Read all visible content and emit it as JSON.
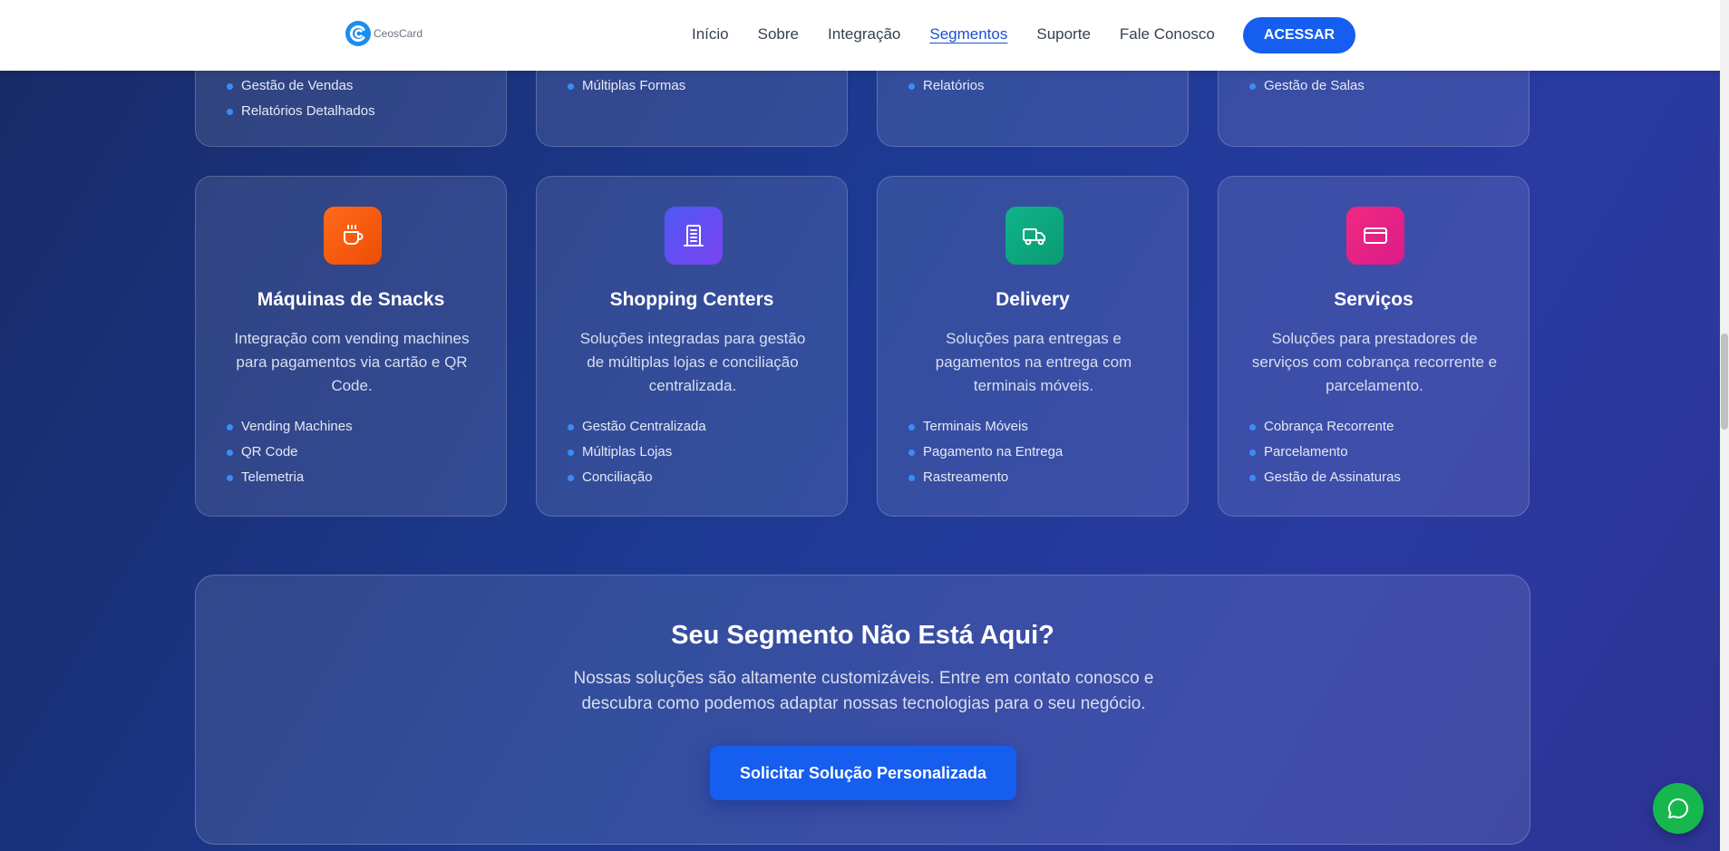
{
  "header": {
    "brand": "CeosCard",
    "nav": [
      "Início",
      "Sobre",
      "Integração",
      "Segmentos",
      "Suporte",
      "Fale Conosco"
    ],
    "active_nav": "Segmentos",
    "access_label": "ACESSAR"
  },
  "top_cards": [
    {
      "items": [
        "Gestão de Vendas",
        "Relatórios Detalhados"
      ]
    },
    {
      "items": [
        "Múltiplas Formas"
      ]
    },
    {
      "items": [
        "Relatórios"
      ]
    },
    {
      "items": [
        "Gestão de Salas"
      ]
    }
  ],
  "cards": [
    {
      "title": "Máquinas de Snacks",
      "icon": "coffee-cup-icon",
      "color": "#f05a0e",
      "description": "Integração com vending machines para pagamentos via cartão e QR Code.",
      "items": [
        "Vending Machines",
        "QR Code",
        "Telemetria"
      ]
    },
    {
      "title": "Shopping Centers",
      "icon": "building-icon",
      "color": "#6d4bf2",
      "description": "Soluções integradas para gestão de múltiplas lojas e conciliação centralizada.",
      "items": [
        "Gestão Centralizada",
        "Múltiplas Lojas",
        "Conciliação"
      ]
    },
    {
      "title": "Delivery",
      "icon": "truck-icon",
      "color": "#0aa77e",
      "description": "Soluções para entregas e pagamentos na entrega com terminais móveis.",
      "items": [
        "Terminais Móveis",
        "Pagamento na Entrega",
        "Rastreamento"
      ]
    },
    {
      "title": "Serviços",
      "icon": "credit-card-icon",
      "color": "#ea1f7a",
      "description": "Soluções para prestadores de serviços com cobrança recorrente e parcelamento.",
      "items": [
        "Cobrança Recorrente",
        "Parcelamento",
        "Gestão de Assinaturas"
      ]
    }
  ],
  "cta": {
    "title": "Seu Segmento Não Está Aqui?",
    "description": "Nossas soluções são altamente customizáveis. Entre em contato conosco e descubra como podemos adaptar nossas tecnologias para o seu negócio.",
    "button_label": "Solicitar Solução Personalizada"
  },
  "chat": {
    "icon": "chat-bubble-icon"
  }
}
